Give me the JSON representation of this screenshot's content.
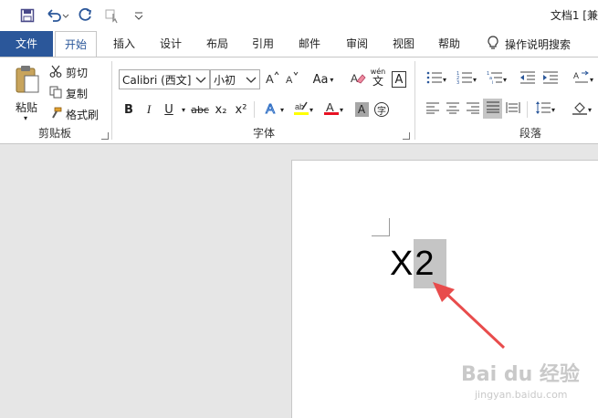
{
  "qat": {
    "document_title": "文档1 [兼"
  },
  "tabs": {
    "file": "文件",
    "home": "开始",
    "insert": "插入",
    "design": "设计",
    "layout": "布局",
    "references": "引用",
    "mailings": "邮件",
    "review": "审阅",
    "view": "视图",
    "help": "帮助",
    "tell_me": "操作说明搜索"
  },
  "clipboard": {
    "paste": "粘贴",
    "cut": "剪切",
    "copy": "复制",
    "format_painter": "格式刷",
    "group_label": "剪贴板"
  },
  "font": {
    "font_name": "Calibri (西文]",
    "font_size": "小初",
    "aa_label": "Aa",
    "bold": "B",
    "italic": "I",
    "underline": "U",
    "strikethrough": "abc",
    "subscript": "x₂",
    "superscript": "x²",
    "phonetic_top": "wén",
    "phonetic_bottom": "文",
    "char_border": "A",
    "enclose": "字",
    "group_label": "字体"
  },
  "paragraph": {
    "group_label": "段落"
  },
  "document": {
    "text_plain": "X",
    "text_selected": "2"
  },
  "watermark": {
    "brand": "Bai du 经验",
    "url": "jingyan.baidu.com"
  },
  "colors": {
    "file_tab": "#2b579a",
    "highlight": "#ffff00",
    "font_color": "#e81123",
    "arrow": "#e84c4c",
    "selection": "#c5c5c5"
  }
}
